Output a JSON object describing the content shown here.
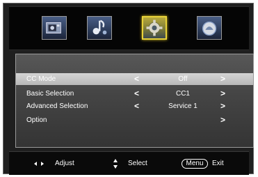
{
  "top_tabs": [
    {
      "icon": "picture-icon",
      "active": false
    },
    {
      "icon": "audio-icon",
      "active": false
    },
    {
      "icon": "cc-settings-icon",
      "active": true
    },
    {
      "icon": "setup-icon",
      "active": false
    }
  ],
  "menu": {
    "rows": [
      {
        "label": "CC Mode",
        "value": "Off",
        "has_left": true,
        "has_right": true,
        "selected": true
      },
      {
        "label": "Basic Selection",
        "value": "CC1",
        "has_left": true,
        "has_right": true,
        "selected": false
      },
      {
        "label": "Advanced Selection",
        "value": "Service 1",
        "has_left": true,
        "has_right": true,
        "selected": false
      },
      {
        "label": "Option",
        "value": "",
        "has_left": false,
        "has_right": true,
        "selected": false
      }
    ],
    "arrow_left": "<",
    "arrow_right": ">"
  },
  "footer": {
    "adjust_label": "Adjust",
    "select_label": "Select",
    "menu_key": "Menu",
    "exit_label": "Exit"
  },
  "colors": {
    "active_tab_border": "#e8d23a",
    "selected_row": "#c8c8c8",
    "panel_bg": "#4a4a4a"
  }
}
